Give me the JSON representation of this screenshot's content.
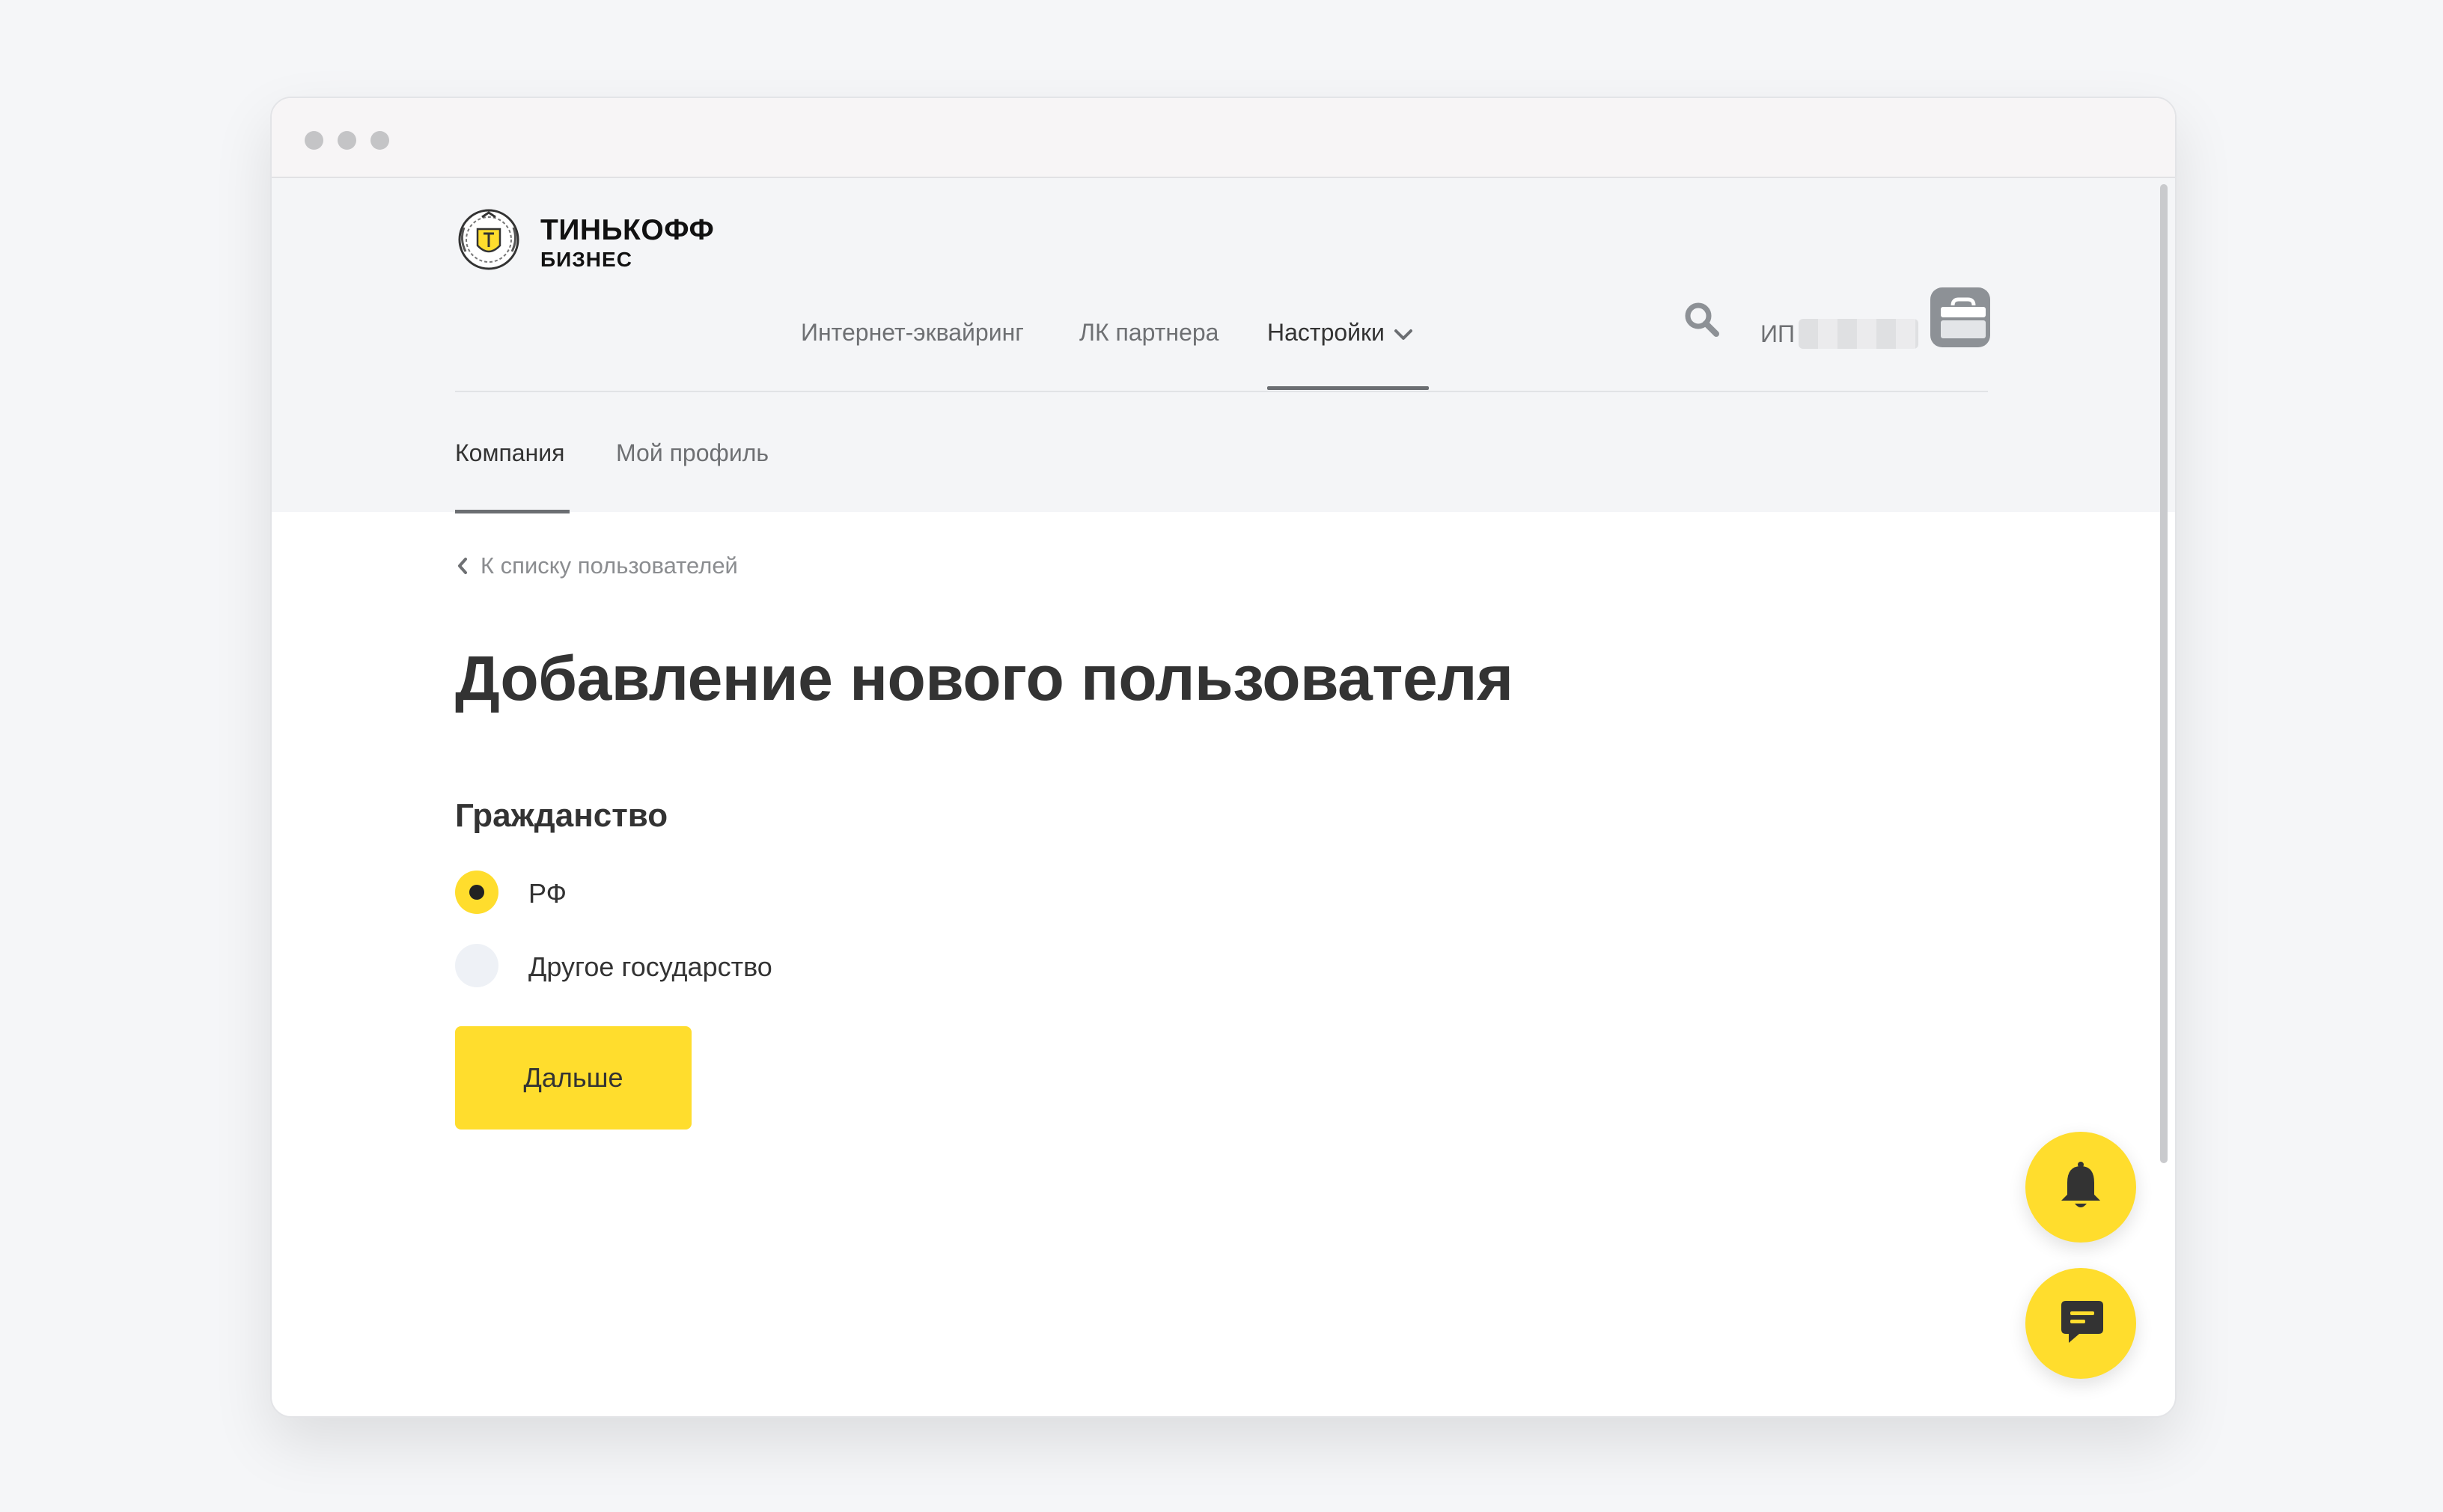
{
  "logo": {
    "line1": "ТИНЬКОФФ",
    "line2": "БИЗНЕС"
  },
  "nav": {
    "items": [
      {
        "label": "Интернет-эквайринг"
      },
      {
        "label": "ЛК партнера"
      },
      {
        "label": "Настройки",
        "active": true
      }
    ]
  },
  "account": {
    "prefix": "ИП",
    "avatar_icon": "briefcase-icon"
  },
  "subnav": {
    "items": [
      {
        "label": "Компания",
        "active": true
      },
      {
        "label": "Мой профиль"
      }
    ]
  },
  "back_link": {
    "label": "К списку пользователей"
  },
  "page_title": "Добавление нового пользователя",
  "citizenship": {
    "title": "Гражданство",
    "options": [
      {
        "label": "РФ",
        "selected": true
      },
      {
        "label": "Другое государство",
        "selected": false
      }
    ]
  },
  "next_button": {
    "label": "Дальше"
  },
  "colors": {
    "accent": "#ffdd2d",
    "text": "#333333",
    "muted": "#6e7073",
    "header_bg": "#f4f5f7"
  },
  "fabs": {
    "notifications_icon": "bell-icon",
    "chat_icon": "chat-icon"
  }
}
